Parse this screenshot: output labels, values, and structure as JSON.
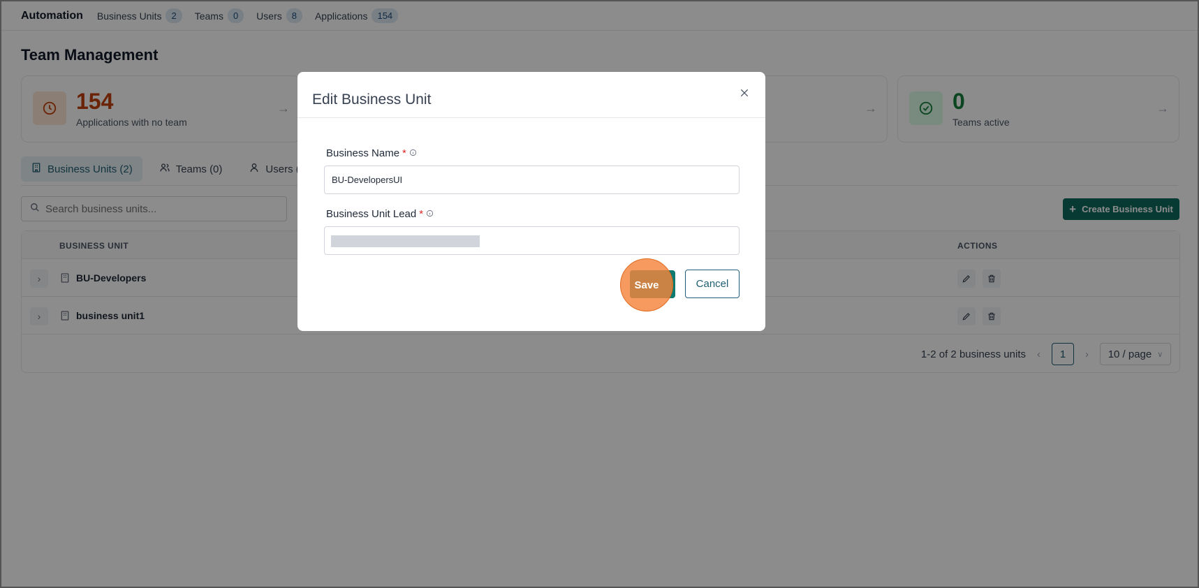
{
  "topnav": {
    "brand": "Automation",
    "items": [
      {
        "label": "Business Units",
        "count": "2"
      },
      {
        "label": "Teams",
        "count": "0"
      },
      {
        "label": "Users",
        "count": "8"
      },
      {
        "label": "Applications",
        "count": "154"
      }
    ]
  },
  "page_title": "Team Management",
  "stats": [
    {
      "value": "154",
      "label": "Applications with no team",
      "color": "#c2410c",
      "icon": "clock-icon"
    },
    {
      "value": "0",
      "label": "Teams active",
      "color": "#15803d",
      "icon": "check-circle-icon"
    }
  ],
  "tabs": [
    {
      "label": "Business Units (2)",
      "icon": "building-icon"
    },
    {
      "label": "Teams (0)",
      "icon": "users-icon"
    },
    {
      "label": "Users (",
      "icon": "user-icon"
    }
  ],
  "search": {
    "placeholder": "Search business units..."
  },
  "create_button": "Create Business Unit",
  "table": {
    "columns": [
      "BUSINESS UNIT",
      "ACTIONS"
    ],
    "rows": [
      {
        "name": "BU-Developers"
      },
      {
        "name": "business unit1"
      }
    ],
    "pagination": {
      "summary": "1-2 of 2 business units",
      "page": "1",
      "per_page": "10 / page"
    }
  },
  "modal": {
    "title": "Edit Business Unit",
    "fields": [
      {
        "label": "Business Name",
        "required": "*",
        "value": "BU-DevelopersUI"
      },
      {
        "label": "Business Unit Lead",
        "required": "*",
        "value": ""
      }
    ],
    "save_label": "Save",
    "cancel_label": "Cancel"
  },
  "colors": {
    "accent": "#0f6a5f",
    "highlight": "#f4843c"
  }
}
